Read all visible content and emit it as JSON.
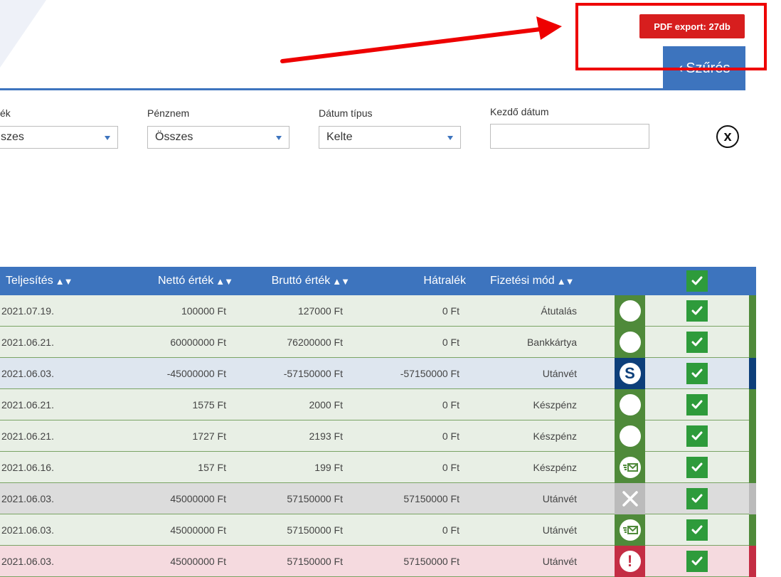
{
  "toolbar": {
    "pdf_export_label": "PDF export: 27db",
    "filter_label": "Szűrés",
    "filter_chevron": "‹"
  },
  "filters": {
    "status_label": "ék",
    "status_value": "szes",
    "currency_label": "Pénznem",
    "currency_value": "Összes",
    "date_type_label": "Dátum típus",
    "date_type_value": "Kelte",
    "start_date_label": "Kezdő dátum",
    "start_date_value": "",
    "clear_icon": "close-circle-icon"
  },
  "table": {
    "headers": {
      "teljesites": "Teljesítés",
      "netto": "Nettó érték",
      "brutto": "Bruttó érték",
      "hatralek": "Hátralék",
      "fizetesi_mod": "Fizetési mód",
      "sort_arrows": "▲▼"
    },
    "rows": [
      {
        "date": "2021.07.19.",
        "net": "100000 Ft",
        "gross": "127000 Ft",
        "due": "0 Ft",
        "method": "Átutalás",
        "status": "blank-circle-icon",
        "bg": "green",
        "bar": "#4f8a3a"
      },
      {
        "date": "2021.06.21.",
        "net": "60000000 Ft",
        "gross": "76200000 Ft",
        "due": "0 Ft",
        "method": "Bankkártya",
        "status": "blank-circle-icon",
        "bg": "green",
        "bar": "#4f8a3a"
      },
      {
        "date": "2021.06.03.",
        "net": "-45000000 Ft",
        "gross": "-57150000 Ft",
        "due": "-57150000 Ft",
        "method": "Utánvét",
        "status": "storno-s-icon",
        "bg": "blue",
        "bar": "#0d3f7a"
      },
      {
        "date": "2021.06.21.",
        "net": "1575 Ft",
        "gross": "2000 Ft",
        "due": "0 Ft",
        "method": "Készpénz",
        "status": "blank-circle-icon",
        "bg": "green",
        "bar": "#4f8a3a"
      },
      {
        "date": "2021.06.21.",
        "net": "1727 Ft",
        "gross": "2193 Ft",
        "due": "0 Ft",
        "method": "Készpénz",
        "status": "blank-circle-icon",
        "bg": "green",
        "bar": "#4f8a3a"
      },
      {
        "date": "2021.06.16.",
        "net": "157 Ft",
        "gross": "199 Ft",
        "due": "0 Ft",
        "method": "Készpénz",
        "status": "email-sent-icon",
        "bg": "green",
        "bar": "#4f8a3a"
      },
      {
        "date": "2021.06.03.",
        "net": "45000000 Ft",
        "gross": "57150000 Ft",
        "due": "57150000 Ft",
        "method": "Utánvét",
        "status": "cancelled-x-icon",
        "bg": "gray",
        "bar": "#bbbbbb"
      },
      {
        "date": "2021.06.03.",
        "net": "45000000 Ft",
        "gross": "57150000 Ft",
        "due": "0 Ft",
        "method": "Utánvét",
        "status": "email-sent-icon",
        "bg": "green",
        "bar": "#4f8a3a"
      },
      {
        "date": "2021.06.03.",
        "net": "45000000 Ft",
        "gross": "57150000 Ft",
        "due": "57150000 Ft",
        "method": "Utánvét",
        "status": "overdue-exclamation-icon",
        "bg": "red",
        "bar": "#c42d44"
      }
    ]
  },
  "colors": {
    "accent_blue": "#3d74be",
    "pdf_red": "#d71e1e",
    "check_green": "#2e9b3b",
    "status_green": "#4f8a3a",
    "status_navy": "#0d3f7a",
    "status_gray": "#bbbbbb",
    "status_red": "#c42d44",
    "annotation_red": "#ee0000"
  }
}
